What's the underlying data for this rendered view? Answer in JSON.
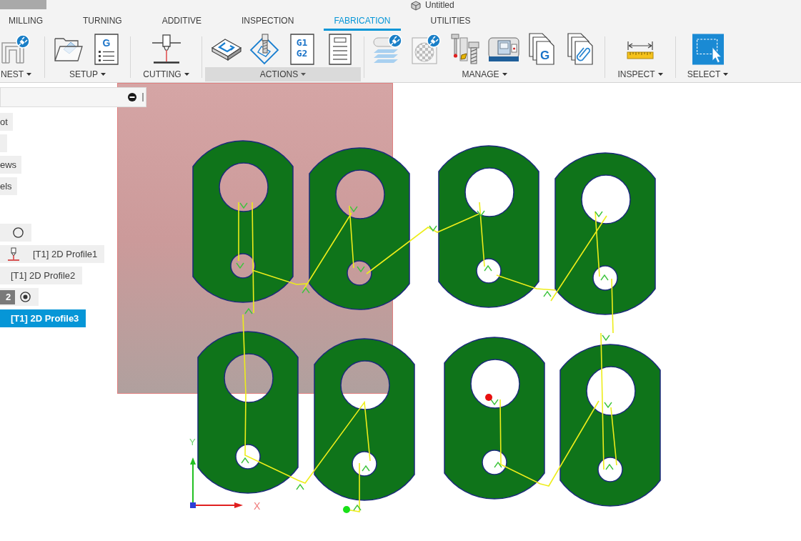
{
  "window": {
    "title": "Untitled"
  },
  "workspace_tabs": [
    {
      "label": "MILLING",
      "selected": false
    },
    {
      "label": "TURNING",
      "selected": false
    },
    {
      "label": "ADDITIVE",
      "selected": false
    },
    {
      "label": "INSPECTION",
      "selected": false
    },
    {
      "label": "FABRICATION",
      "selected": true
    },
    {
      "label": "UTILITIES",
      "selected": false
    }
  ],
  "toolbar_groups": [
    {
      "label": "NEST",
      "highlighted": false,
      "tools": [
        {
          "kind": "nest"
        }
      ]
    },
    {
      "label": "SETUP",
      "highlighted": false,
      "tools": [
        {
          "kind": "folder"
        },
        {
          "kind": "g_doc",
          "text": "G"
        }
      ]
    },
    {
      "label": "CUTTING",
      "highlighted": false,
      "tools": [
        {
          "kind": "laser"
        }
      ]
    },
    {
      "label": "ACTIONS",
      "highlighted": true,
      "tools": [
        {
          "kind": "simulate"
        },
        {
          "kind": "toolpath"
        },
        {
          "kind": "nc_doc",
          "lines": [
            "G1",
            "G2"
          ]
        },
        {
          "kind": "sheet"
        }
      ]
    },
    {
      "label": "MANAGE",
      "highlighted": false,
      "tools": [
        {
          "kind": "post_plug"
        },
        {
          "kind": "checker_plug"
        },
        {
          "kind": "tool_library"
        },
        {
          "kind": "machine"
        },
        {
          "kind": "multi_g",
          "text": "G"
        },
        {
          "kind": "multi_clip"
        }
      ]
    },
    {
      "label": "INSPECT",
      "highlighted": false,
      "tools": [
        {
          "kind": "measure"
        }
      ]
    },
    {
      "label": "SELECT",
      "highlighted": false,
      "tools": [
        {
          "kind": "select"
        }
      ]
    }
  ],
  "browser": {
    "items": [
      {
        "kind": "folder",
        "label": "ot",
        "selected": false
      },
      {
        "kind": "folder",
        "selected": false
      },
      {
        "kind": "folder",
        "label": "ews",
        "selected": false
      },
      {
        "kind": "folder",
        "label": "els",
        "selected": false
      },
      {
        "kind": "setup",
        "active": false,
        "selected": false
      },
      {
        "kind": "operation",
        "tool_icon": true,
        "label": "[T1] 2D Profile1",
        "selected": false
      },
      {
        "kind": "operation",
        "tool_icon": false,
        "label": "[T1] 2D Profile2",
        "selected": false
      },
      {
        "kind": "setup",
        "badge": "2",
        "active": true,
        "selected": false
      },
      {
        "kind": "operation",
        "tool_icon": false,
        "label": "[T1] 2D Profile3",
        "selected": true
      }
    ]
  },
  "canvas": {
    "axis_labels": {
      "x": "X",
      "y": "Y"
    }
  }
}
